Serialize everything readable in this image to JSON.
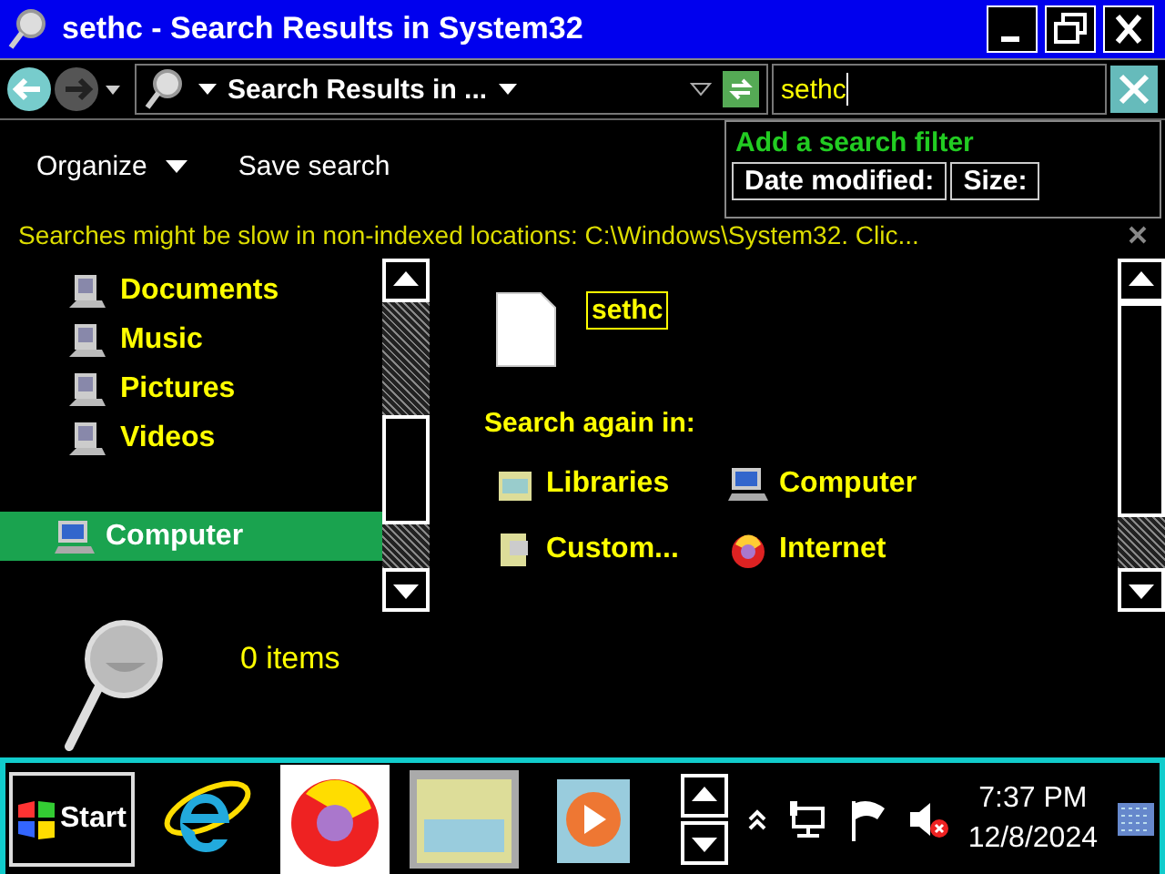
{
  "window": {
    "title": "sethc - Search Results in System32"
  },
  "address_bar": {
    "breadcrumb": "Search Results in ...",
    "search": {
      "value": "sethc"
    }
  },
  "search_suggestions": {
    "heading": "Add a search filter",
    "filters": [
      "Date modified:",
      "Size:"
    ]
  },
  "toolbar": {
    "buttons": [
      {
        "label": "Organize",
        "kind": "menu"
      },
      {
        "label": "Save search",
        "kind": "plain"
      }
    ]
  },
  "info_bar": {
    "text": "Searches might be slow in non-indexed locations: C:\\Windows\\System32. Clic..."
  },
  "nav_pane": {
    "items": [
      {
        "label": "Documents",
        "kind": "library",
        "selected": false
      },
      {
        "label": "Music",
        "kind": "library",
        "selected": false
      },
      {
        "label": "Pictures",
        "kind": "library",
        "selected": false
      },
      {
        "label": "Videos",
        "kind": "library",
        "selected": false
      },
      {
        "label": "Computer",
        "kind": "computer",
        "selected": true
      }
    ]
  },
  "results": {
    "files": [
      {
        "name": "sethc",
        "selected": true
      }
    ],
    "search_again": {
      "heading": "Search again in:",
      "locations": [
        {
          "label": "Libraries",
          "kind": "libraries"
        },
        {
          "label": "Computer",
          "kind": "computer"
        },
        {
          "label": "Custom...",
          "kind": "custom"
        },
        {
          "label": "Internet",
          "kind": "internet"
        }
      ]
    }
  },
  "details_pane": {
    "count": "0 items"
  },
  "taskbar": {
    "start": "Start",
    "apps": [
      {
        "kind": "browser",
        "selected": false
      },
      {
        "kind": "firefox",
        "selected": false
      },
      {
        "kind": "explorer",
        "selected": true
      },
      {
        "kind": "media",
        "selected": false
      }
    ],
    "clock": {
      "time": "7:37 PM",
      "date": "12/8/2024"
    }
  }
}
